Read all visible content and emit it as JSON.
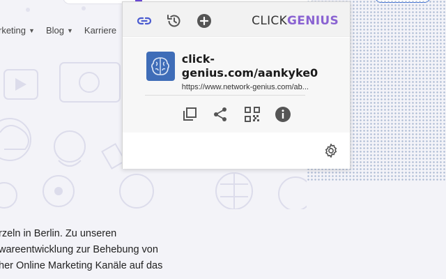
{
  "background": {
    "nav_items": [
      {
        "label": "rketing",
        "caret": "▼"
      },
      {
        "label": "Blog",
        "caret": "▼"
      },
      {
        "label": "Karriere",
        "caret": ""
      }
    ],
    "body_lines": [
      "rzeln in Berlin. Zu unseren",
      "wareentwicklung zur Behebung von",
      "her Online Marketing Kanäle auf das"
    ]
  },
  "popup": {
    "brand_part1": "CLICK",
    "brand_part2": "GENIUS",
    "toolbar_icons": [
      "link-icon",
      "history-icon",
      "add-circle-icon"
    ],
    "short_url": "click-genius.com/aankyke0",
    "long_url": "https://www.network-genius.com/ab...",
    "action_icons": [
      "copy-icon",
      "share-icon",
      "qr-code-icon",
      "info-icon"
    ],
    "footer_icon": "gear-icon"
  },
  "colors": {
    "brand_accent": "#8a63d2",
    "link_icon": "#4a5bd0",
    "logo_bg": "#3f6db8",
    "icon_gray": "#555555"
  }
}
